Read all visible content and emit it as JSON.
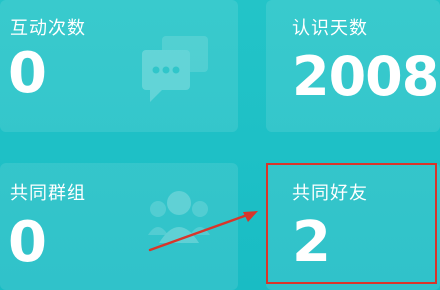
{
  "stats": [
    {
      "label": "互动次数",
      "value": "0"
    },
    {
      "label": "认识天数",
      "value": "2008"
    },
    {
      "label": "共同群组",
      "value": "0"
    },
    {
      "label": "共同好友",
      "value": "2"
    }
  ],
  "icons": {
    "interaction_card": "chat-bubbles-icon",
    "groups_card": "group-people-icon"
  },
  "colors": {
    "background": "#1ec0c6",
    "annotation": "#d8352a"
  }
}
